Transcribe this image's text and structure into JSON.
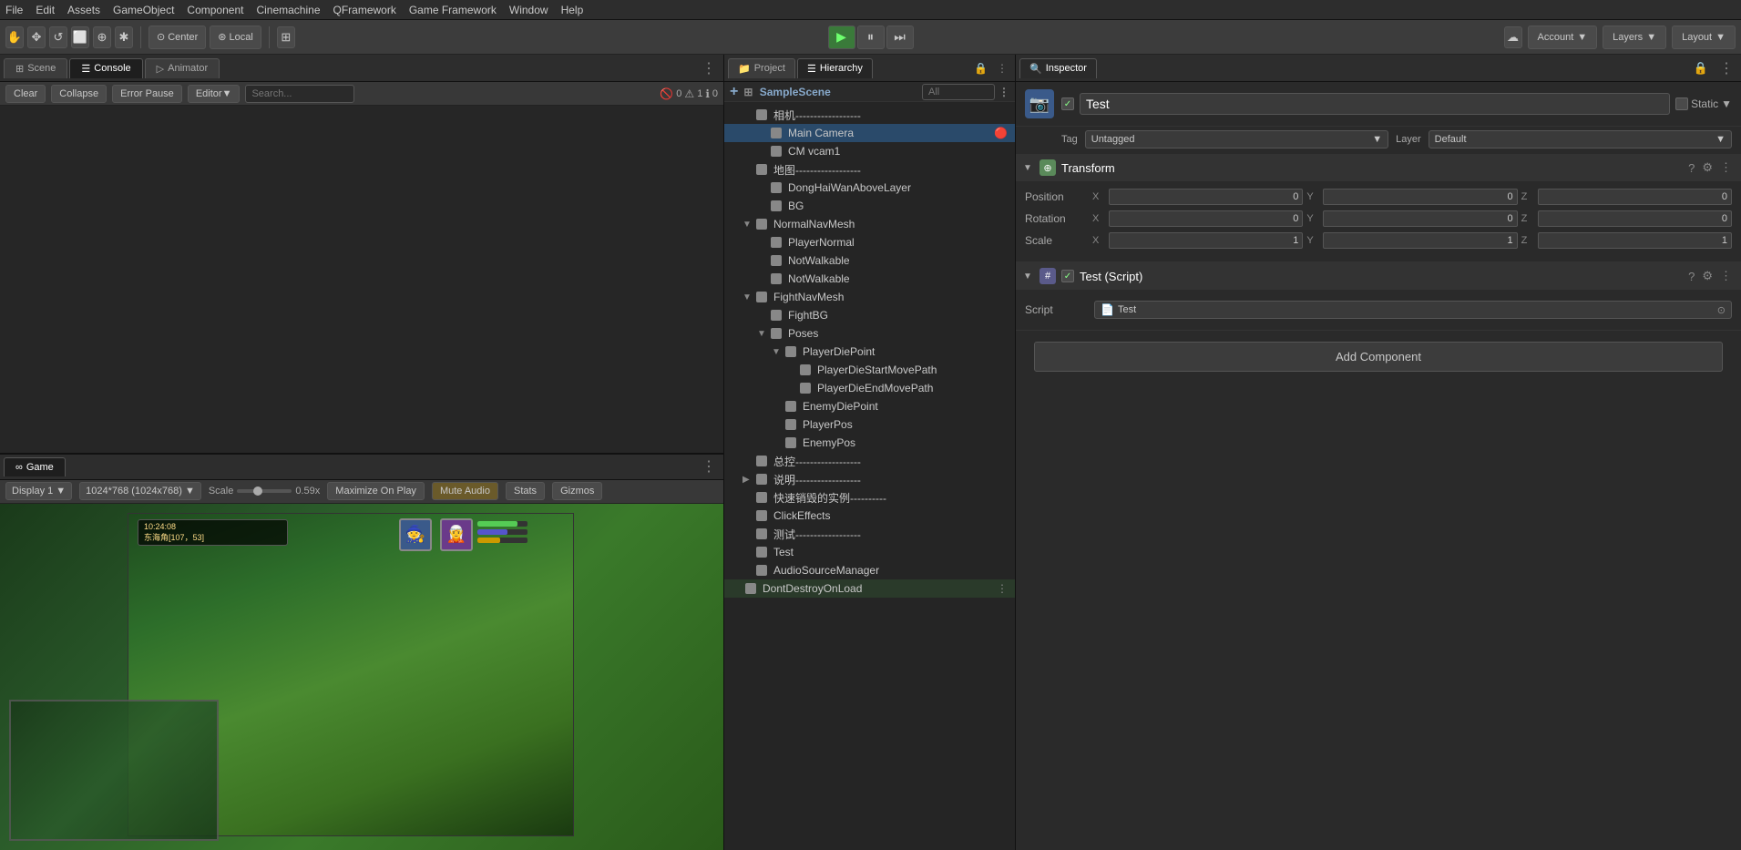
{
  "menubar": {
    "items": [
      "File",
      "Edit",
      "Assets",
      "GameObject",
      "Component",
      "Cinemachine",
      "QFramework",
      "Game Framework",
      "Window",
      "Help"
    ]
  },
  "toolbar": {
    "hand_tool": "✋",
    "move_tool": "✥",
    "rotate_tool": "↺",
    "rect_tool": "⬜",
    "transform_tool": "⊕",
    "custom_tool": "✱",
    "center_label": "Center",
    "local_label": "Local",
    "snap_icon": "⊞",
    "play_icon": "▶",
    "pause_icon": "⏸",
    "step_icon": "⏭",
    "account_label": "Account",
    "layers_label": "Layers",
    "layout_label": "Layout"
  },
  "scene_tabs": {
    "scene_tab": "Scene",
    "console_tab": "Console",
    "animator_tab": "Animator"
  },
  "console_toolbar": {
    "clear_label": "Clear",
    "collapse_label": "Collapse",
    "error_pause_label": "Error Pause",
    "editor_label": "Editor",
    "search_placeholder": "Search...",
    "error_count": "0",
    "warning_count": "1",
    "info_count": "0"
  },
  "game_tabs": {
    "game_tab": "Game"
  },
  "game_toolbar": {
    "display_label": "Display 1",
    "resolution_label": "1024*768 (1024x768)",
    "scale_label": "Scale",
    "scale_value": "0.59x",
    "maximize_label": "Maximize On Play",
    "mute_label": "Mute Audio",
    "stats_label": "Stats",
    "gizmos_label": "Gizmos"
  },
  "hierarchy": {
    "project_tab": "Project",
    "hierarchy_tab": "Hierarchy",
    "search_placeholder": "All",
    "scene_name": "SampleScene",
    "items": [
      {
        "name": "相机------------------",
        "indent": 1,
        "has_arrow": false,
        "icon": "go"
      },
      {
        "name": "Main Camera",
        "indent": 2,
        "has_arrow": false,
        "icon": "go",
        "selected": true,
        "has_tag": true
      },
      {
        "name": "CM vcam1",
        "indent": 2,
        "has_arrow": false,
        "icon": "go"
      },
      {
        "name": "地图------------------",
        "indent": 1,
        "has_arrow": false,
        "icon": "go"
      },
      {
        "name": "DongHaiWanAboveLayer",
        "indent": 2,
        "has_arrow": false,
        "icon": "go"
      },
      {
        "name": "BG",
        "indent": 2,
        "has_arrow": false,
        "icon": "go"
      },
      {
        "name": "NormalNavMesh",
        "indent": 1,
        "has_arrow": true,
        "arrow_open": true,
        "icon": "go"
      },
      {
        "name": "PlayerNormal",
        "indent": 2,
        "has_arrow": false,
        "icon": "go"
      },
      {
        "name": "NotWalkable",
        "indent": 2,
        "has_arrow": false,
        "icon": "go"
      },
      {
        "name": "NotWalkable",
        "indent": 2,
        "has_arrow": false,
        "icon": "go"
      },
      {
        "name": "FightNavMesh",
        "indent": 1,
        "has_arrow": true,
        "arrow_open": true,
        "icon": "go"
      },
      {
        "name": "FightBG",
        "indent": 2,
        "has_arrow": false,
        "icon": "go"
      },
      {
        "name": "Poses",
        "indent": 2,
        "has_arrow": true,
        "arrow_open": true,
        "icon": "go"
      },
      {
        "name": "PlayerDiePoint",
        "indent": 3,
        "has_arrow": true,
        "arrow_open": true,
        "icon": "go"
      },
      {
        "name": "PlayerDieStartMovePath",
        "indent": 4,
        "has_arrow": false,
        "icon": "go"
      },
      {
        "name": "PlayerDieEndMovePath",
        "indent": 4,
        "has_arrow": false,
        "icon": "go"
      },
      {
        "name": "EnemyDiePoint",
        "indent": 3,
        "has_arrow": false,
        "icon": "go"
      },
      {
        "name": "PlayerPos",
        "indent": 3,
        "has_arrow": false,
        "icon": "go"
      },
      {
        "name": "EnemyPos",
        "indent": 3,
        "has_arrow": false,
        "icon": "go"
      },
      {
        "name": "总控------------------",
        "indent": 1,
        "has_arrow": false,
        "icon": "go"
      },
      {
        "name": "说明------------------",
        "indent": 1,
        "has_arrow": true,
        "arrow_open": false,
        "icon": "go"
      },
      {
        "name": "快速销毁的实例----------",
        "indent": 1,
        "has_arrow": false,
        "icon": "go"
      },
      {
        "name": "ClickEffects",
        "indent": 1,
        "has_arrow": false,
        "icon": "go"
      },
      {
        "name": "测试------------------",
        "indent": 1,
        "has_arrow": false,
        "icon": "go"
      },
      {
        "name": "Test",
        "indent": 1,
        "has_arrow": false,
        "icon": "go"
      },
      {
        "name": "AudioSourceManager",
        "indent": 1,
        "has_arrow": false,
        "icon": "go"
      },
      {
        "name": "DontDestroyOnLoad",
        "indent": 0,
        "has_arrow": false,
        "icon": "go",
        "is_scene": true
      }
    ]
  },
  "inspector": {
    "tab_label": "Inspector",
    "object_name": "Test",
    "static_label": "Static",
    "tag_label": "Tag",
    "tag_value": "Untagged",
    "layer_label": "Layer",
    "layer_value": "Default",
    "transform": {
      "section_name": "Transform",
      "position_label": "Position",
      "position_x": "0",
      "position_y": "0",
      "position_z": "0",
      "rotation_label": "Rotation",
      "rotation_x": "0",
      "rotation_y": "0",
      "rotation_z": "0",
      "scale_label": "Scale",
      "scale_x": "1",
      "scale_y": "1",
      "scale_z": "1"
    },
    "script_component": {
      "section_name": "Test (Script)",
      "script_label": "Script",
      "script_value": "Test"
    },
    "add_component_label": "Add Component"
  },
  "hud": {
    "time": "10:24:08",
    "coords": "东海角[107，53]"
  }
}
